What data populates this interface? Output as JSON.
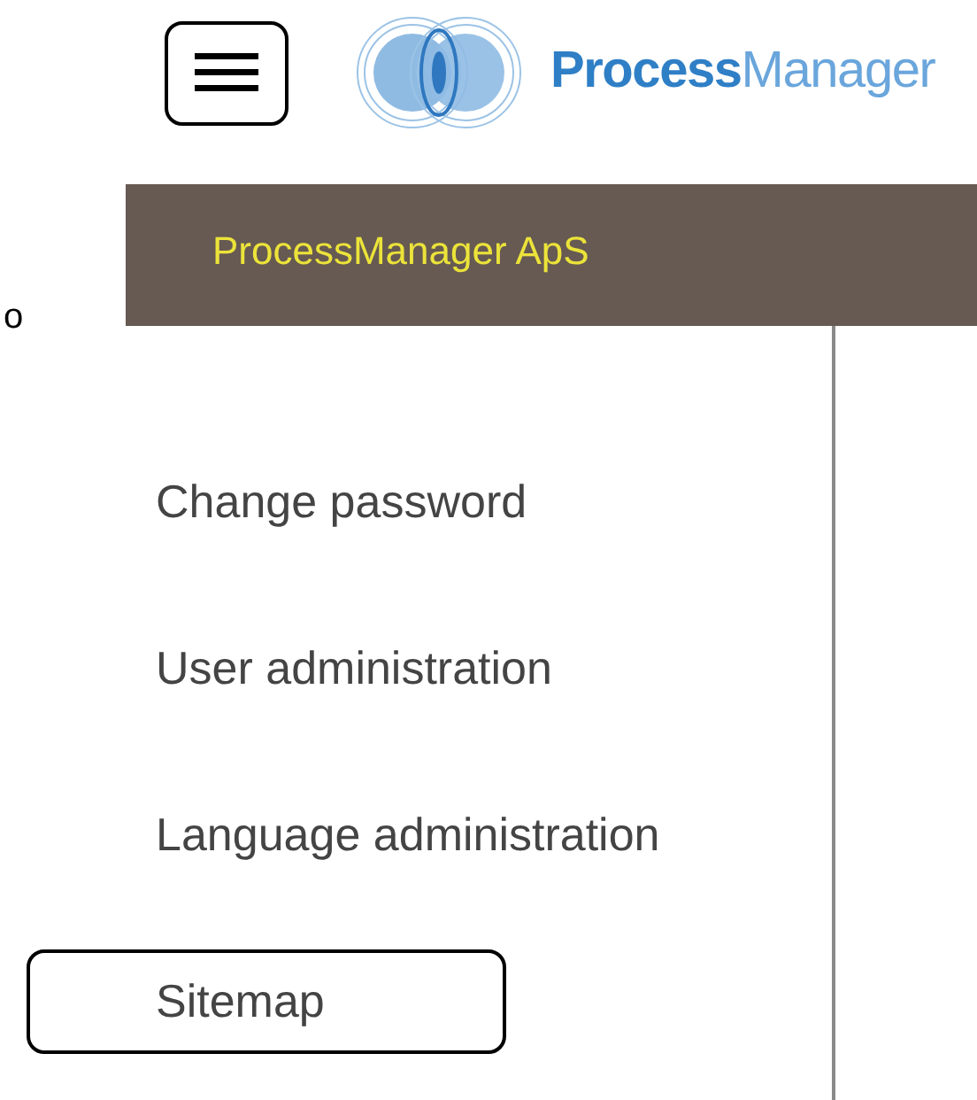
{
  "header": {
    "logo_text_bold": "Process",
    "logo_text_light": "Manager"
  },
  "company_bar": {
    "title": "ProcessManager ApS"
  },
  "side_text": "o",
  "menu": [
    {
      "label": "Change password",
      "selected": false
    },
    {
      "label": "User administration",
      "selected": false
    },
    {
      "label": "Language administration",
      "selected": false
    },
    {
      "label": "Sitemap",
      "selected": true
    }
  ]
}
